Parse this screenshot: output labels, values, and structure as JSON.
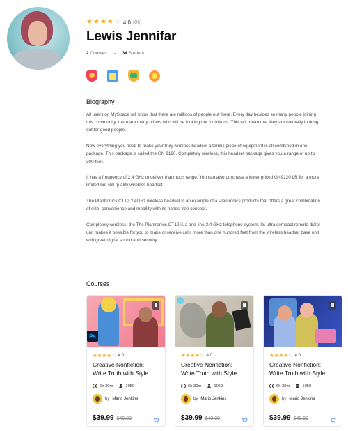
{
  "profile": {
    "name": "Lewis Jennifar",
    "rating": "4.0",
    "review_count": "(06)",
    "stars": [
      true,
      true,
      true,
      true,
      false
    ],
    "courses_count": "2",
    "courses_label": "Courses",
    "students_count": "34",
    "students_label": "Student",
    "badges": [
      "award-badge-icon",
      "book-badge-icon",
      "graduation-badge-icon",
      "medal-badge-icon"
    ]
  },
  "biography": {
    "title": "Biography",
    "paragraphs": [
      "All users on MySpace will know that there are millions of people out there. Every day besides so many people joining this community, there are many others who will be looking out for friends. This will mean that they are naturally looking out for good people.",
      "Now everything you need to make your truly wireless headset a terrific piece of equipment is all combined in one package. This package is called the GN 9120. Completely wireless, this headset package gives you a range of up to 300 feet.",
      "It has a frequency of 2.4 GHz to deliver that much range. You can also purchase a lower priced GN9120 LR for a more limited but still quality wireless headset.",
      "The Plantronics CT12 2.4GHz wireless headset is an example of a Plantronics products that offers a great combination of size, convenience and mobility with its hands-free concept.",
      "Completely cordless, the The Plantronics CT12 is a one-line 2.4 GHz telephone system. Its ultra compact remote dialer unit makes it possible for you to make or receive calls more than one hundred feet from the wireless headset base unit with great digital sound and security."
    ]
  },
  "courses": {
    "title": "Courses",
    "items": [
      {
        "rating": "4.0",
        "title": "Creative Nonfiction: Write Truth with Style",
        "duration": "6h 30m",
        "students": "1050",
        "author_prefix": "by",
        "author": "Mario Jenkins",
        "price": "$39.99",
        "old_price": "$49.99",
        "app_badge": "Ps"
      },
      {
        "rating": "4.0",
        "title": "Creative Nonfiction: Write Truth with Style",
        "duration": "6h 30m",
        "students": "1050",
        "author_prefix": "by",
        "author": "Mario Jenkins",
        "price": "$39.99",
        "old_price": "$49.99"
      },
      {
        "rating": "4.0",
        "title": "Creative Nonfiction: Write Truth with Style",
        "duration": "6h 30m",
        "students": "1050",
        "author_prefix": "by",
        "author": "Mario Jenkins",
        "price": "$39.99",
        "old_price": "$49.99"
      }
    ]
  },
  "colors": {
    "star": "#f2b01e",
    "star_empty": "#c7c7c7",
    "cart": "#3b82f6"
  }
}
